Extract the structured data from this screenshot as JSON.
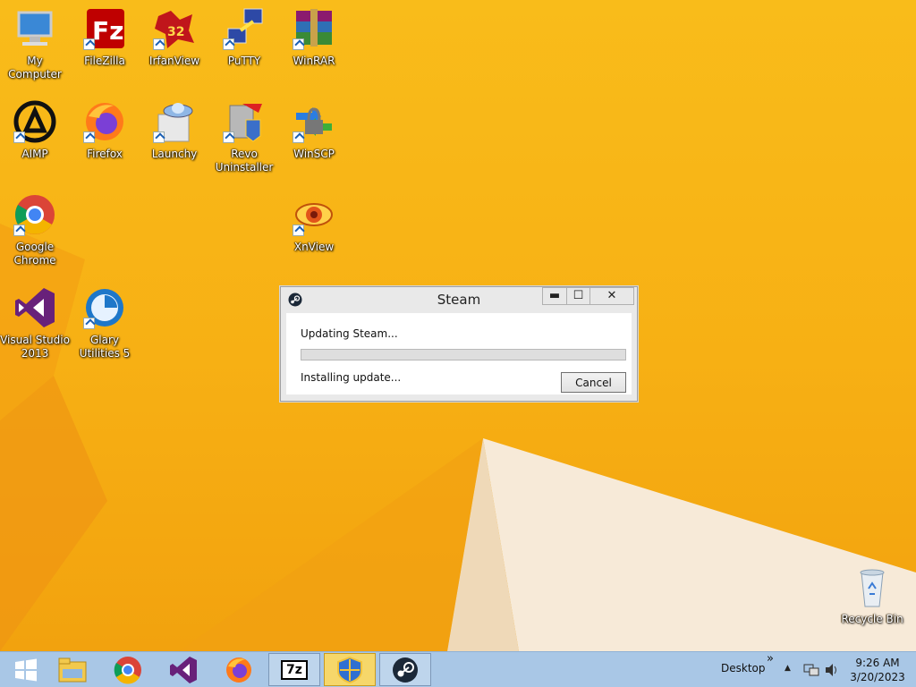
{
  "desktop": {
    "icons": [
      {
        "label": "My Computer"
      },
      {
        "label": "FileZilla"
      },
      {
        "label": "IrfanView"
      },
      {
        "label": "PuTTY"
      },
      {
        "label": "WinRAR"
      },
      {
        "label": "AIMP"
      },
      {
        "label": "Firefox"
      },
      {
        "label": "Launchy"
      },
      {
        "label": "Revo Uninstaller"
      },
      {
        "label": "WinSCP"
      },
      {
        "label": "Google Chrome"
      },
      {
        "label": "XnView"
      },
      {
        "label": "Visual Studio 2013"
      },
      {
        "label": "Glary Utilities 5"
      },
      {
        "label": "Recycle Bin"
      }
    ]
  },
  "steam_dialog": {
    "title": "Steam",
    "minimize_label": "▬",
    "maximize_label": "☐",
    "close_label": "✕",
    "heading": "Updating Steam...",
    "progress": 0,
    "status": "Installing update...",
    "cancel_label": "Cancel"
  },
  "taskbar": {
    "desktop_label": "Desktop",
    "chevron": "»",
    "tray_arrow": "▲",
    "time": "9:26 AM",
    "date": "3/20/2023",
    "sevenzip_label": "7z",
    "pinned": [
      "start-icon",
      "file-explorer-icon",
      "chrome-icon",
      "visual-studio-icon",
      "firefox-icon",
      "7zip-icon",
      "security-shield-icon",
      "steam-icon"
    ]
  },
  "colors": {
    "wallpaper": "#f7b014",
    "taskbar": "#a9c7e6",
    "progress_fill": "#26a0da"
  }
}
